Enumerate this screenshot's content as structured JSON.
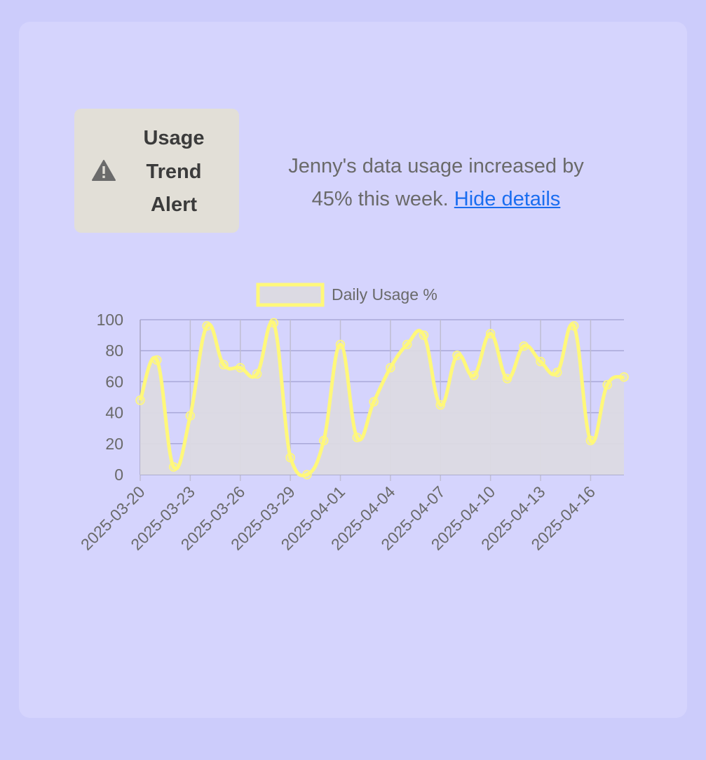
{
  "alert": {
    "icon": "warning-triangle-icon",
    "title_lines": [
      "Usage",
      "Trend",
      "Alert"
    ],
    "message": "Jenny's data usage increased by 45% this week.",
    "link_label": "Hide details"
  },
  "colors": {
    "page_background": "#ccccfb",
    "card_background": "#d5d4fd",
    "alert_background": "#e2dfd7",
    "link": "#1a6df0",
    "series_line": "#fff87a",
    "series_fill": "#dcdae3",
    "grid": "#a9a8d8"
  },
  "chart_data": {
    "type": "area",
    "title": "",
    "xlabel": "",
    "ylabel": "",
    "ylim": [
      0,
      100
    ],
    "y_ticks": [
      0,
      20,
      40,
      60,
      80,
      100
    ],
    "grid": true,
    "legend_position": "top",
    "x_tick_labels": [
      "2025-03-20",
      "2025-03-23",
      "2025-03-26",
      "2025-03-29",
      "2025-04-01",
      "2025-04-04",
      "2025-04-07",
      "2025-04-10",
      "2025-04-13",
      "2025-04-16"
    ],
    "x": [
      "2025-03-20",
      "2025-03-21",
      "2025-03-22",
      "2025-03-23",
      "2025-03-24",
      "2025-03-25",
      "2025-03-26",
      "2025-03-27",
      "2025-03-28",
      "2025-03-29",
      "2025-03-30",
      "2025-03-31",
      "2025-04-01",
      "2025-04-02",
      "2025-04-03",
      "2025-04-04",
      "2025-04-05",
      "2025-04-06",
      "2025-04-07",
      "2025-04-08",
      "2025-04-09",
      "2025-04-10",
      "2025-04-11",
      "2025-04-12",
      "2025-04-13",
      "2025-04-14",
      "2025-04-15",
      "2025-04-16",
      "2025-04-17",
      "2025-04-18"
    ],
    "series": [
      {
        "name": "Daily Usage %",
        "values": [
          48,
          74,
          5,
          38,
          96,
          71,
          69,
          65,
          98,
          11,
          0,
          22,
          84,
          24,
          47,
          69,
          84,
          90,
          45,
          77,
          64,
          91,
          62,
          83,
          73,
          66,
          96,
          22,
          58,
          63
        ]
      }
    ]
  }
}
